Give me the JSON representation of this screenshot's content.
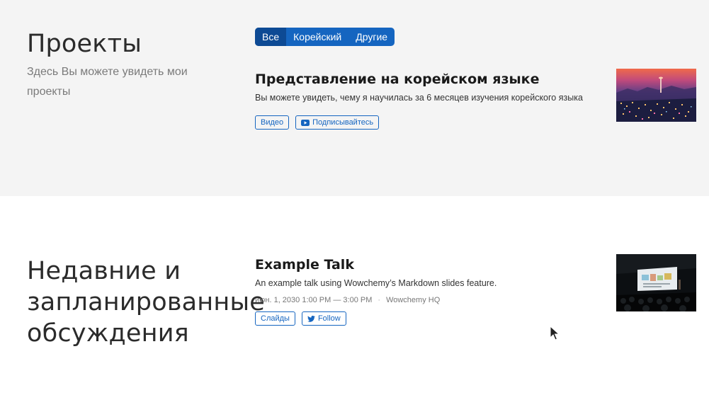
{
  "projects": {
    "title": "Проекты",
    "subtitle": "Здесь Вы можете увидеть мои проекты",
    "filters": [
      "Все",
      "Корейский",
      "Другие"
    ],
    "active_filter": "Все",
    "item": {
      "title": "Представление на корейском языке",
      "summary": "Вы можете увидеть, чему я научилась за 6 месяцев изучения корейского языка",
      "buttons": {
        "video": "Видео",
        "subscribe": "Подписывайтесь",
        "subscribe_icon": "youtube-icon"
      },
      "thumbnail": "city-night-image"
    }
  },
  "talks": {
    "title": "Недавние и запланированные обсуждения",
    "item": {
      "title": "Example Talk",
      "summary": "An example talk using Wowchemy’s Markdown slides feature.",
      "date": "июн. 1, 2030 1:00 PM — 3:00 PM",
      "separator": "·",
      "location": "Wowchemy HQ",
      "buttons": {
        "slides": "Слайды",
        "follow": "Follow",
        "follow_icon": "twitter-icon"
      },
      "thumbnail": "conference-stage-image"
    }
  },
  "colors": {
    "accent": "#1565c0",
    "accent_active": "#0d4a94",
    "section_bg": "#f4f4f4"
  }
}
